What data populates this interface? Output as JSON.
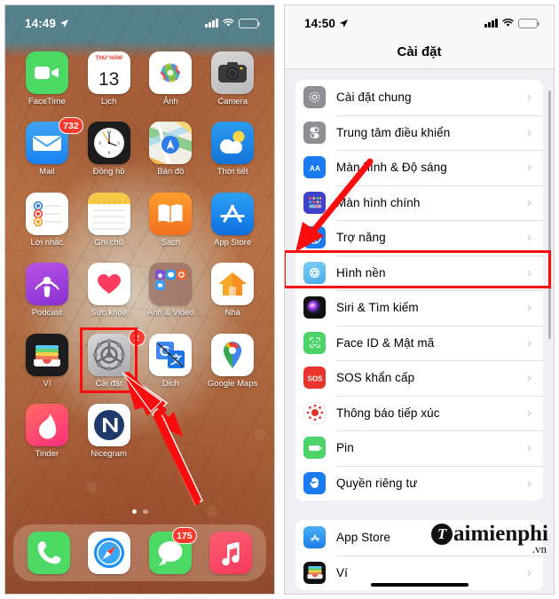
{
  "left_phone": {
    "status_bar": {
      "time": "14:49",
      "location_icon": "location-arrow-icon",
      "cellular_icon": "signal-bars-icon",
      "wifi_icon": "wifi-icon",
      "battery_icon": "battery-icon"
    },
    "apps": [
      {
        "label": "FaceTime",
        "icon": "facetime-icon",
        "badge": ""
      },
      {
        "label": "Lịch",
        "icon": "calendar-icon",
        "badge": "",
        "cal_top": "THỨ NĂM",
        "cal_day": "13"
      },
      {
        "label": "Ảnh",
        "icon": "photos-icon",
        "badge": ""
      },
      {
        "label": "Camera",
        "icon": "camera-icon",
        "badge": ""
      },
      {
        "label": "Mail",
        "icon": "mail-icon",
        "badge": "732"
      },
      {
        "label": "Đồng hồ",
        "icon": "clock-icon",
        "badge": ""
      },
      {
        "label": "Bản đồ",
        "icon": "maps-icon",
        "badge": ""
      },
      {
        "label": "Thời tiết",
        "icon": "weather-icon",
        "badge": ""
      },
      {
        "label": "Lời nhắc",
        "icon": "reminders-icon",
        "badge": ""
      },
      {
        "label": "Ghi chú",
        "icon": "notes-icon",
        "badge": ""
      },
      {
        "label": "Sách",
        "icon": "books-icon",
        "badge": ""
      },
      {
        "label": "App Store",
        "icon": "app-store-icon",
        "badge": ""
      },
      {
        "label": "Podcast",
        "icon": "podcasts-icon",
        "badge": ""
      },
      {
        "label": "Sức khỏe",
        "icon": "health-icon",
        "badge": ""
      },
      {
        "label": "Ảnh & Video",
        "icon": "folder-icon",
        "badge": ""
      },
      {
        "label": "Nhà",
        "icon": "home-app-icon",
        "badge": ""
      },
      {
        "label": "Ví",
        "icon": "wallet-icon",
        "badge": ""
      },
      {
        "label": "Cài đặt",
        "icon": "settings-gear-icon",
        "badge": "2"
      },
      {
        "label": "Dịch",
        "icon": "google-translate-icon",
        "badge": ""
      },
      {
        "label": "Google Maps",
        "icon": "google-maps-icon",
        "badge": ""
      },
      {
        "label": "Tinder",
        "icon": "tinder-icon",
        "badge": ""
      },
      {
        "label": "Nicegram",
        "icon": "nicegram-icon",
        "badge": ""
      }
    ],
    "dock": [
      {
        "label": "Phone",
        "icon": "phone-icon",
        "badge": ""
      },
      {
        "label": "Safari",
        "icon": "safari-icon",
        "badge": ""
      },
      {
        "label": "Messages",
        "icon": "messages-icon",
        "badge": "175"
      },
      {
        "label": "Music",
        "icon": "music-icon",
        "badge": ""
      }
    ],
    "page_dots": {
      "count": 2,
      "active_index": 0
    },
    "annotation": {
      "highlight_target": "Cài đặt",
      "arrow_icon": "red-arrow-icon",
      "box_color": "#fb0d0d"
    }
  },
  "right_phone": {
    "status_bar": {
      "time": "14:50",
      "location_icon": "location-arrow-icon",
      "cellular_icon": "signal-bars-icon",
      "wifi_icon": "wifi-icon",
      "battery_icon": "battery-icon"
    },
    "nav_title": "Cài đặt",
    "groups": [
      {
        "rows": [
          {
            "label": "Cài đặt chung",
            "icon": "general-gear-icon",
            "chevron": "›"
          },
          {
            "label": "Trung tâm điều khiển",
            "icon": "control-center-icon",
            "chevron": "›"
          },
          {
            "label": "Màn hình & Độ sáng",
            "icon": "display-brightness-icon",
            "chevron": "›"
          },
          {
            "label": "Màn hình chính",
            "icon": "home-screen-icon",
            "chevron": "›"
          },
          {
            "label": "Trợ năng",
            "icon": "accessibility-icon",
            "chevron": "›"
          },
          {
            "label": "Hình nền",
            "icon": "wallpaper-icon",
            "chevron": "›"
          },
          {
            "label": "Siri & Tìm kiếm",
            "icon": "siri-icon",
            "chevron": "›"
          },
          {
            "label": "Face ID & Mật mã",
            "icon": "face-id-icon",
            "chevron": "›"
          },
          {
            "label": "SOS khẩn cấp",
            "icon": "sos-icon",
            "chevron": "›"
          },
          {
            "label": "Thông báo tiếp xúc",
            "icon": "exposure-notification-icon",
            "chevron": "›"
          },
          {
            "label": "Pin",
            "icon": "battery-settings-icon",
            "chevron": "›"
          },
          {
            "label": "Quyền riêng tư",
            "icon": "privacy-hand-icon",
            "chevron": "›"
          }
        ]
      },
      {
        "rows": [
          {
            "label": "App Store",
            "icon": "app-store-icon",
            "chevron": "›"
          },
          {
            "label": "Ví",
            "icon": "wallet-icon",
            "chevron": "›"
          }
        ]
      }
    ],
    "annotation": {
      "highlight_target": "Hình nền",
      "arrow_icon": "red-arrow-icon",
      "box_color": "#fb0d0d"
    }
  },
  "watermark": {
    "logo_letter": "T",
    "text": "aimienphi",
    "domain": ".vn"
  }
}
